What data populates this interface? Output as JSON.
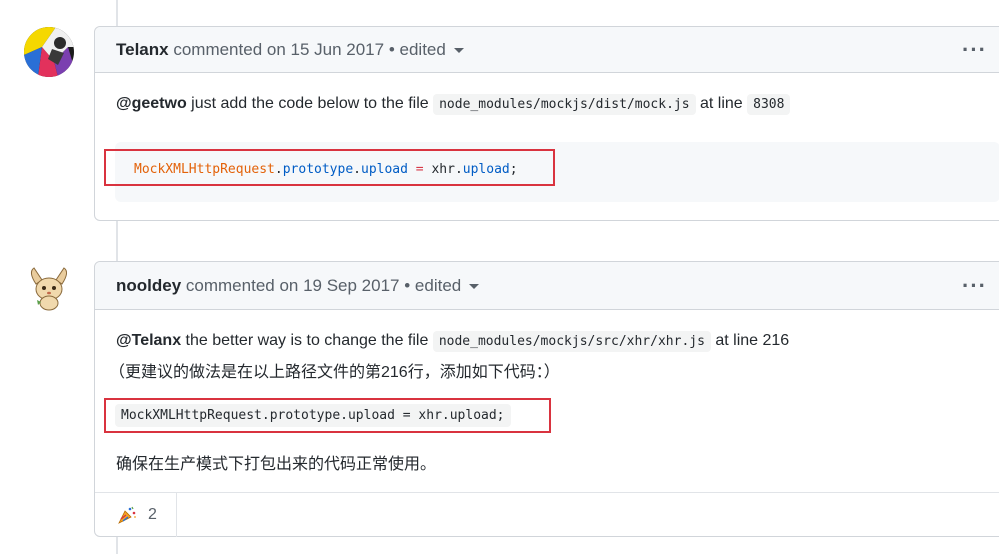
{
  "comments": [
    {
      "author": "Telanx",
      "meta": "commented on 15 Jun 2017",
      "edited_label": "• edited",
      "menu_icon": "kebab-horizontal-icon",
      "body": {
        "mention": "@geetwo",
        "text_before_code": " just add the code below to the file ",
        "file_code": "node_modules/mockjs/dist/mock.js",
        "text_after_code": " at line ",
        "line_code": "8308",
        "code_block": {
          "class_name": "MockXMLHttpRequest",
          "dot1": ".",
          "prop1": "prototype",
          "dot2": ".",
          "prop2": "upload",
          "op": " = ",
          "obj": "xhr",
          "dot3": ".",
          "prop3": "upload",
          "end": ";"
        }
      }
    },
    {
      "author": "nooldey",
      "meta": "commented on 19 Sep 2017",
      "edited_label": "• edited",
      "menu_icon": "kebab-horizontal-icon",
      "body": {
        "mention": "@Telanx",
        "text_before_code": " the better way is to change the file ",
        "file_code": "node_modules/mockjs/src/xhr/xhr.js",
        "text_after_code": " at line 216",
        "line2": "（更建议的做法是在以上路径文件的第216行，添加如下代码：）",
        "inline_code": "MockXMLHttpRequest.prototype.upload = xhr.upload;",
        "closing": "确保在生产模式下打包出来的代码正常使用。"
      },
      "reactions": [
        {
          "icon": "tada-icon",
          "count": "2"
        }
      ]
    }
  ],
  "colors": {
    "annotation_red": "#d9333f",
    "header_bg": "#f6f8fa",
    "border": "#d1d5da"
  }
}
